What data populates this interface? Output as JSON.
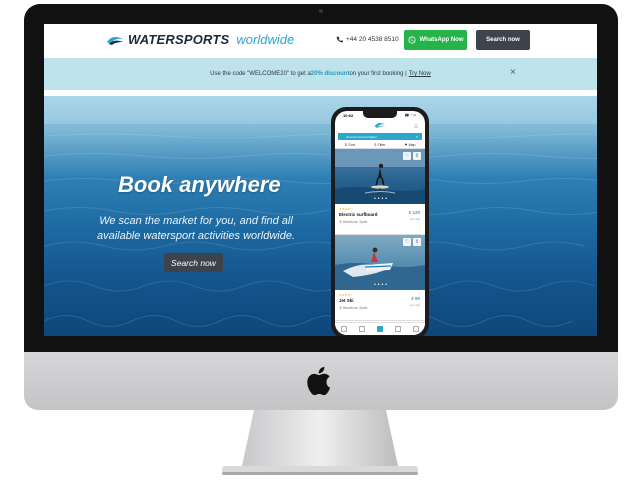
{
  "header": {
    "brand_bold": "WATERSPORTS",
    "brand_light": "worldwide",
    "phone": "+44 20 4538 8510",
    "whatsapp_label": "WhatsApp Now",
    "search_label": "Search now"
  },
  "promo": {
    "prefix": "Use the code \"WELCOME20\" to get a ",
    "discount": "20% discount",
    "suffix": "on your first booking |",
    "link": "Try Now",
    "close": "×"
  },
  "hero": {
    "title": "Book anywhere",
    "subtitle": "We scan the market for you, and find all available watersport activities worldwide.",
    "button": "Search now"
  },
  "phone_app": {
    "time": "10:02",
    "status": "▮▮ ◔ ▭",
    "search_text": "Around current location",
    "search_close": "×",
    "menu": "☰",
    "filters": [
      "⇅ Sort",
      "⚲ Filter",
      "⚑ Map"
    ],
    "listings": [
      {
        "stars": "★★★★☆",
        "title": "Electric surfboard",
        "location": "⦿ Barcelona, Spain",
        "price": "€ 120",
        "per": "per day"
      },
      {
        "stars": "★★★★☆",
        "title": "Jet Ski",
        "location": "⦿ Barcelona, Spain",
        "price": "€ 90",
        "per": "per day"
      }
    ],
    "dots": "• • • •"
  },
  "colors": {
    "accent": "#2ba6cf",
    "whatsapp": "#25b34a",
    "dark_button": "#3d444b",
    "promo_bg": "#bfe3ea"
  }
}
